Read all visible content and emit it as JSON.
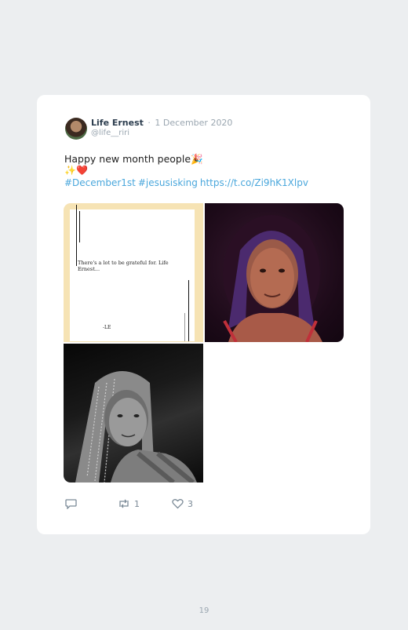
{
  "tweet": {
    "author_name": "Life Ernest",
    "separator": "·",
    "date": "1 December 2020",
    "handle": "@life__riri",
    "text_line1": "Happy new month people",
    "emoji_line1": "🎉",
    "emoji_line2": "✨❤️",
    "hashtag1": "#December1st",
    "hashtag2": "#jesusisking",
    "link": "https://t.co/Zi9hK1Xlpv"
  },
  "media": {
    "image1_quote": "There's a lot to be grateful for. Life Ernest...",
    "image1_signature": "-LE"
  },
  "actions": {
    "reply_count": "",
    "retweet_count": "1",
    "like_count": "3"
  },
  "page_number": "19"
}
